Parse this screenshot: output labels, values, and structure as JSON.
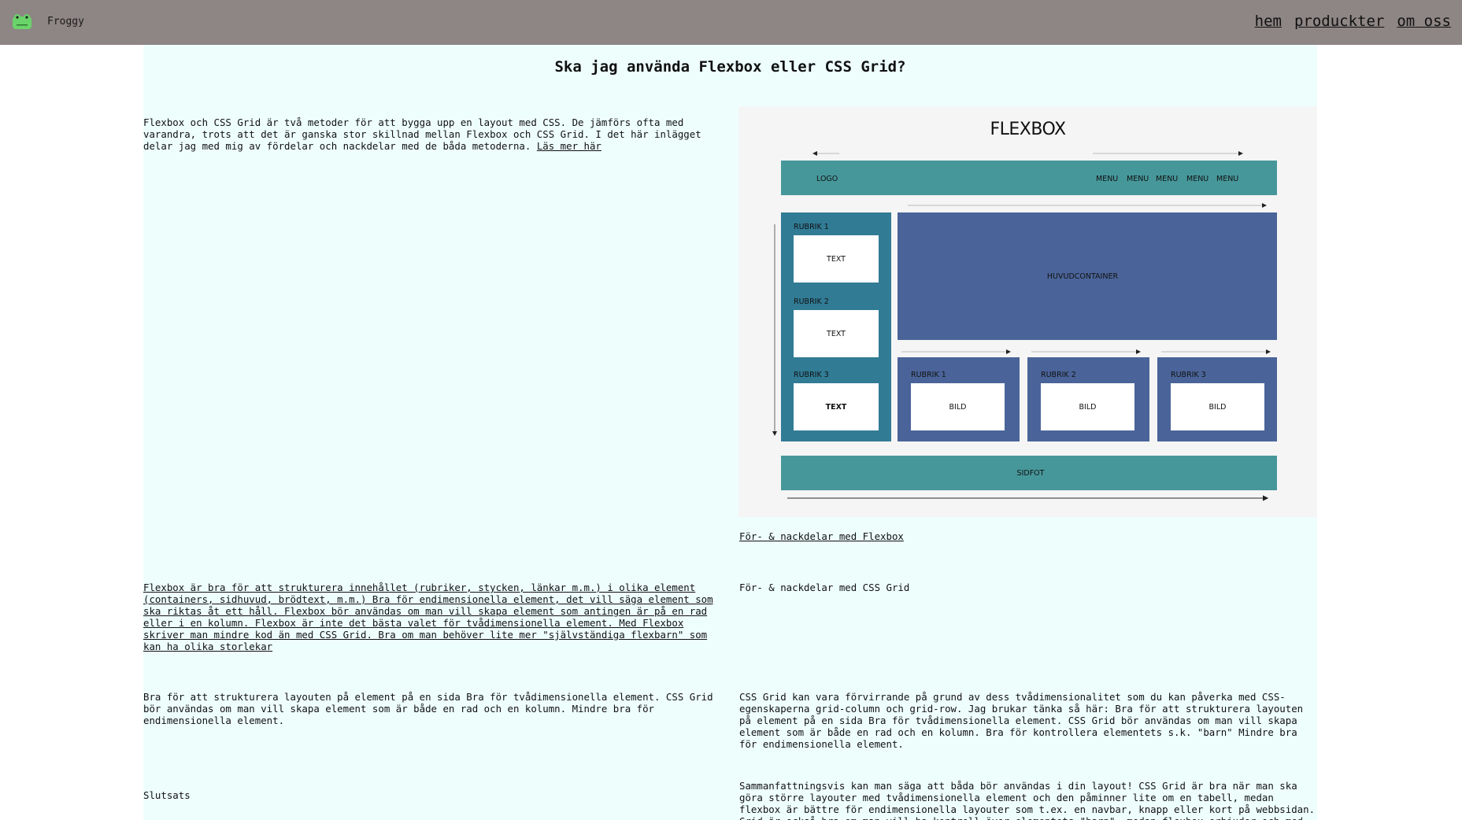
{
  "header": {
    "brand": "Froggy",
    "logo_icon": "frog-icon",
    "nav": [
      "hem",
      "produckter",
      "om oss"
    ]
  },
  "article": {
    "title": "Ska jag använda Flexbox eller CSS Grid?",
    "intro": "Flexbox och CSS Grid är två metoder för att bygga upp en layout med CSS. De jämförs ofta med varandra, trots att det är ganska stor skillnad mellan Flexbox och CSS Grid. I det här inlägget delar jag med mig av fördelar och nackdelar med de båda metoderna.",
    "read_more": "Läs mer här",
    "flexbox_link": "För- & nackdelar med Flexbox",
    "grid_heading": "För- & nackdelar med CSS Grid",
    "flexbox_text": "Flexbox är bra för att strukturera innehållet (rubriker, stycken, länkar m.m.) i olika element (containers, sidhuvud, brödtext, m.m.) Bra för endimensionella element, det vill säga element som ska riktas åt ett håll. Flexbox bör användas om man vill skapa element som antingen är på en rad eller i en kolumn. Flexbox är inte det bästa valet för tvådimensionella element. Med Flexbox skriver man mindre kod än med CSS Grid. Bra om man behöver lite mer \"självständiga flexbarn\" som kan ha olika storlekar",
    "grid_left_text": "Bra för att strukturera layouten på element på en sida Bra för tvådimensionella element. CSS Grid bör användas om man vill skapa element som är både en rad och en kolumn. Mindre bra för endimensionella element.",
    "grid_right_text": "CSS Grid kan vara förvirrande på grund av dess tvådimensionalitet som du kan påverka med CSS-egenskaperna grid-column och grid-row. Jag brukar tänka så här: Bra för att strukturera layouten på element på en sida Bra för tvådimensionella element. CSS Grid bör användas om man vill skapa element som är både en rad och en kolumn. Bra för kontrollera elementets s.k. \"barn\" Mindre bra för endimensionella element.",
    "conclusion_heading": "Slutsats",
    "conclusion_text": "Sammanfattningsvis kan man säga att båda bör användas i din layout! CSS Grid är bra när man ska göra större layouter med tvådimensionella element och den påminner lite om en tabell, medan flexbox är bättre för endimensionella layouter som t.ex. en navbar, knapp eller kort på webbsidan. Grid är också bra om man vill ha kontroll över elementets \"barn\", medan flexbox erbjuder och med mindre kod tillåter"
  },
  "diagram": {
    "title": "FLEXBOX",
    "logo": "LOGO",
    "menu": [
      "MENU",
      "MENU",
      "MENU",
      "MENU",
      "MENU"
    ],
    "side": [
      {
        "heading": "RUBRIK 1",
        "box": "TEXT"
      },
      {
        "heading": "RUBRIK 2",
        "box": "TEXT"
      },
      {
        "heading": "RUBRIK 3",
        "box": "TEXT"
      }
    ],
    "main": "HUVUDCONTAINER",
    "cards": [
      {
        "heading": "RUBRIK 1",
        "box": "BILD"
      },
      {
        "heading": "RUBRIK 2",
        "box": "BILD"
      },
      {
        "heading": "RUBRIK 3",
        "box": "BILD"
      }
    ],
    "footer": "SIDFOT"
  },
  "colors": {
    "header_bg": "#8e8585",
    "main_bg": "#eefefd",
    "teal": "#46979a",
    "side": "#317b95",
    "blue": "#4a6499"
  }
}
